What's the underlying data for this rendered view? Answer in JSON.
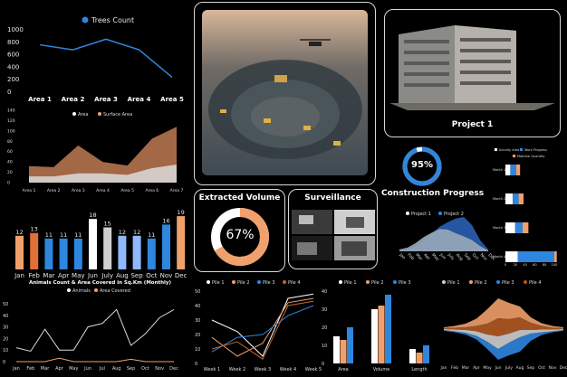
{
  "colors": {
    "blue": "#2e86de",
    "orange": "#f0a06c",
    "grey": "#cfcfcf",
    "darkorange": "#c0682e",
    "lightblue": "#8fb8ff"
  },
  "trees": {
    "legend": "Trees Count",
    "chart_data": {
      "type": "line",
      "categories": [
        "Area 1",
        "Area 2",
        "Area 3",
        "Area 4",
        "Area 5"
      ],
      "series": [
        {
          "name": "Trees Count",
          "values": [
            760,
            680,
            850,
            680,
            240
          ]
        }
      ],
      "yticks": [
        0,
        200,
        400,
        600,
        800,
        1000
      ],
      "ylim": [
        0,
        1000
      ]
    }
  },
  "surface": {
    "legend": [
      "Area",
      "Surface Area"
    ],
    "chart_data": {
      "type": "area",
      "categories": [
        "Area 1",
        "Area 2",
        "Area 3",
        "Area 4",
        "Area 5",
        "Area 6",
        "Area 7"
      ],
      "series": [
        {
          "name": "Area",
          "values": [
            12,
            12,
            18,
            18,
            15,
            28,
            35
          ]
        },
        {
          "name": "Surface Area",
          "values": [
            32,
            30,
            72,
            40,
            33,
            85,
            108
          ]
        }
      ],
      "yticks": [
        0,
        20,
        40,
        60,
        80,
        100,
        120,
        140
      ],
      "ylim": [
        0,
        140
      ]
    }
  },
  "monthly": {
    "chart_data": {
      "type": "bar",
      "categories": [
        "Jan",
        "Feb",
        "Mar",
        "Apr",
        "May",
        "Jun",
        "July",
        "Aug",
        "Sep",
        "Oct",
        "Nov",
        "Dec"
      ],
      "values": [
        12,
        13,
        11,
        11,
        11,
        18,
        15,
        12,
        12,
        11,
        16,
        19
      ],
      "ylim": [
        0,
        20
      ]
    }
  },
  "drone": {
    "label": "drone construction site aerial photo"
  },
  "project": {
    "title": "Project 1"
  },
  "extracted": {
    "title": "Extracted Volume",
    "percent": "67%",
    "value": 67
  },
  "surveillance": {
    "title": "Surveillance"
  },
  "construction": {
    "title": "Construction Progress",
    "percent": "95%",
    "value": 95,
    "legend": [
      "Project 1",
      "Project 2"
    ],
    "chart_data": {
      "type": "area",
      "categories": [
        "Jan",
        "Feb",
        "Mar",
        "Apr",
        "May",
        "Jun",
        "July",
        "Aug",
        "Sep",
        "Oct",
        "Nov",
        "Dec"
      ],
      "series": [
        {
          "name": "Project 1",
          "values": [
            5,
            10,
            22,
            38,
            50,
            60,
            58,
            48,
            40,
            30,
            14,
            2
          ]
        },
        {
          "name": "Project 2",
          "values": [
            2,
            6,
            14,
            30,
            48,
            66,
            78,
            88,
            92,
            70,
            30,
            5
          ]
        }
      ]
    }
  },
  "months_bar": {
    "legend": [
      "Activity Area",
      "Work Progress",
      "Material Quantity"
    ],
    "chart_data": {
      "type": "bar",
      "categories": [
        "Month 1",
        "Month 2",
        "Month 3",
        "Month 4"
      ],
      "series": [
        {
          "name": "Activity Area",
          "values": [
            10,
            15,
            20,
            25
          ]
        },
        {
          "name": "Work Progress",
          "values": [
            12,
            12,
            15,
            75
          ]
        },
        {
          "name": "Material Quantity",
          "values": [
            8,
            10,
            12,
            5
          ]
        }
      ],
      "xticks": [
        0,
        20,
        40,
        60,
        80,
        100
      ]
    }
  },
  "animals": {
    "title": "Animals Count & Area Covered in Sq.Km (Monthly)",
    "legend": [
      "Animals",
      "Area Covered"
    ],
    "chart_data": {
      "type": "line",
      "categories": [
        "Jan",
        "Feb",
        "Mar",
        "Apr",
        "May",
        "Jun",
        "Jul",
        "Aug",
        "Sep",
        "Oct",
        "Nov",
        "Dec"
      ],
      "series": [
        {
          "name": "Animals",
          "values": [
            12,
            9,
            28,
            10,
            10,
            30,
            33,
            45,
            14,
            24,
            38,
            45
          ]
        },
        {
          "name": "Area Covered",
          "values": [
            0,
            0,
            0,
            3,
            0,
            0,
            0,
            0,
            2,
            0,
            0,
            0
          ]
        }
      ],
      "yticks": [
        0,
        10,
        20,
        30,
        40,
        50
      ],
      "ylim": [
        0,
        50
      ]
    }
  },
  "piles": {
    "legend": [
      "Pile 1",
      "Pile 2",
      "Pile 3",
      "Pile 4"
    ],
    "chart_data": {
      "type": "line",
      "categories": [
        "Week 1",
        "Week 2",
        "Week 3",
        "Week 4",
        "Week 5"
      ],
      "series": [
        {
          "name": "Pile 1",
          "values": [
            30,
            22,
            5,
            45,
            48
          ]
        },
        {
          "name": "Pile 2",
          "values": [
            18,
            5,
            14,
            42,
            45
          ]
        },
        {
          "name": "Pile 3",
          "values": [
            8,
            18,
            20,
            33,
            40
          ]
        },
        {
          "name": "Pile 4",
          "values": [
            10,
            15,
            3,
            40,
            43
          ]
        }
      ],
      "yticks": [
        0,
        10,
        20,
        30,
        40,
        50
      ],
      "ylim": [
        0,
        50
      ]
    }
  },
  "volume": {
    "legend": [
      "Pile 1",
      "Pile 2",
      "Pile 3"
    ],
    "chart_data": {
      "type": "bar",
      "categories": [
        "Area",
        "Volume",
        "Length"
      ],
      "series": [
        {
          "name": "Pile 1",
          "values": [
            15,
            30,
            8
          ]
        },
        {
          "name": "Pile 2",
          "values": [
            13,
            32,
            6
          ]
        },
        {
          "name": "Pile 3",
          "values": [
            20,
            38,
            10
          ]
        }
      ],
      "yticks": [
        0,
        10,
        20,
        30,
        40
      ],
      "ylim": [
        0,
        40
      ]
    }
  },
  "stream": {
    "legend": [
      "Pile 1",
      "Pile 2",
      "Pile 3",
      "Pile 4"
    ],
    "chart_data": {
      "type": "area",
      "categories": [
        "Jan",
        "Feb",
        "Mar",
        "Apr",
        "May",
        "Jun",
        "July",
        "Aug",
        "Sep",
        "Oct",
        "Nov",
        "Dec"
      ],
      "series": [
        {
          "name": "Pile 1",
          "values": [
            1,
            2,
            3,
            5,
            8,
            14,
            10,
            8,
            4,
            3,
            2,
            1
          ]
        },
        {
          "name": "Pile 2",
          "values": [
            1,
            2,
            4,
            8,
            16,
            22,
            18,
            12,
            6,
            3,
            2,
            1
          ]
        },
        {
          "name": "Pile 3",
          "values": [
            1,
            1,
            2,
            4,
            8,
            12,
            14,
            16,
            8,
            3,
            1,
            1
          ]
        },
        {
          "name": "Pile 4",
          "values": [
            1,
            2,
            3,
            6,
            12,
            20,
            16,
            14,
            8,
            4,
            2,
            1
          ]
        }
      ]
    }
  }
}
